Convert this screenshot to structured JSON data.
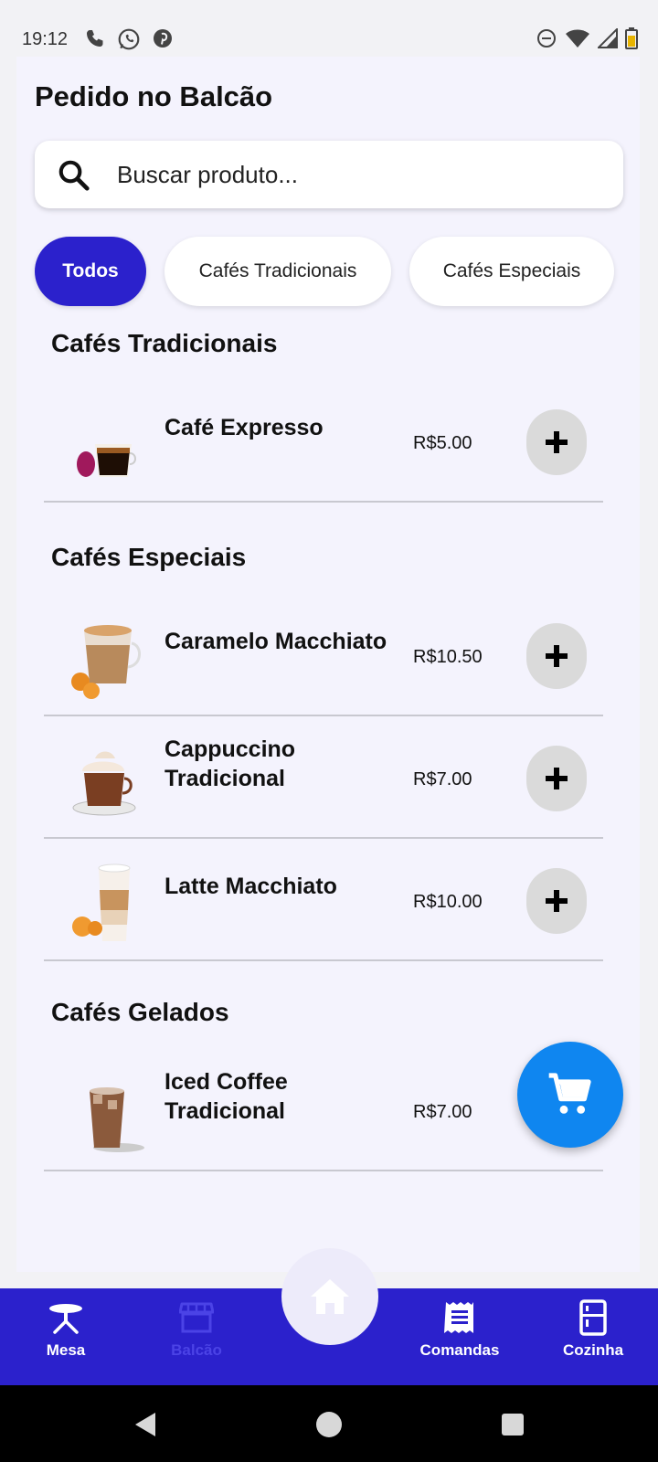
{
  "status_bar": {
    "time": "19:12",
    "left_icons": [
      "phone-icon",
      "whatsapp-icon",
      "pinterest-icon"
    ],
    "right_icons": [
      "dnd-icon",
      "wifi-icon",
      "signal-icon",
      "battery-icon"
    ]
  },
  "header": {
    "title": "Pedido no Balcão"
  },
  "search": {
    "placeholder": "Buscar produto..."
  },
  "filters": {
    "chips": [
      {
        "label": "Todos",
        "active": true
      },
      {
        "label": "Cafés Tradicionais",
        "active": false
      },
      {
        "label": "Cafés Especiais",
        "active": false
      }
    ]
  },
  "sections": [
    {
      "title": "Cafés Tradicionais",
      "products": [
        {
          "name": "Café Expresso",
          "price": "R$5.00"
        }
      ]
    },
    {
      "title": "Cafés Especiais",
      "products": [
        {
          "name": "Caramelo Macchiato",
          "price": "R$10.50"
        },
        {
          "name": "Cappuccino Tradicional",
          "price": "R$7.00"
        },
        {
          "name": "Latte Macchiato",
          "price": "R$10.00"
        }
      ]
    },
    {
      "title": "Cafés Gelados",
      "products": [
        {
          "name": "Iced Coffee Tradicional",
          "price": "R$7.00"
        }
      ]
    }
  ],
  "bottom_nav": {
    "items": [
      {
        "label": "Mesa",
        "icon": "table-icon",
        "active": false
      },
      {
        "label": "Balcão",
        "icon": "store-icon",
        "active": true
      },
      {
        "label": "Comandas",
        "icon": "receipt-icon",
        "active": false
      },
      {
        "label": "Cozinha",
        "icon": "fridge-icon",
        "active": false
      }
    ],
    "center": {
      "icon": "home-icon"
    }
  },
  "colors": {
    "primary": "#2B21CC",
    "fab": "#0F86F0",
    "background": "#F4F3FD",
    "add_button": "#DADADA"
  }
}
